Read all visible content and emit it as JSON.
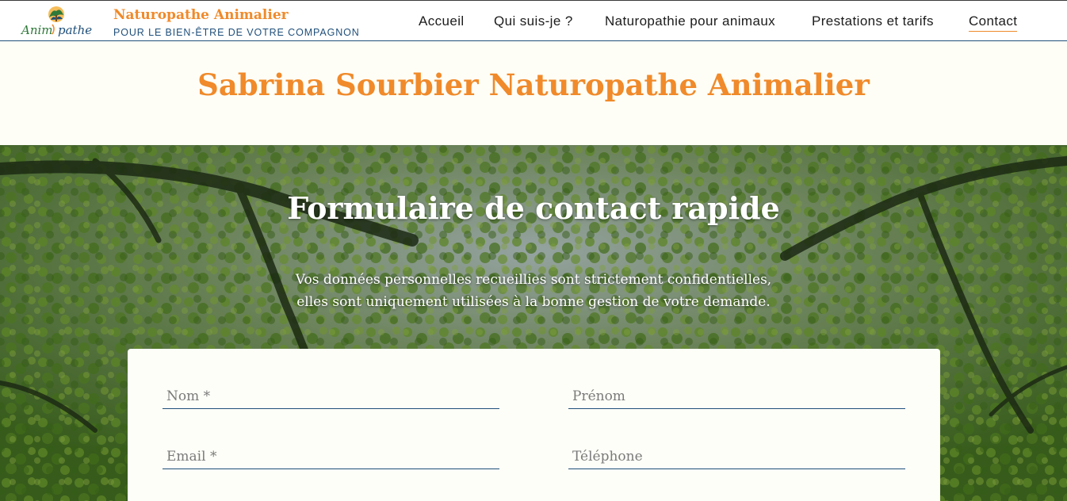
{
  "brand": {
    "logo_text": "Anim pathe",
    "name": "Naturopathe Animalier",
    "tagline": "POUR LE BIEN-ÊTRE DE VOTRE COMPAGNON"
  },
  "nav": {
    "items": [
      {
        "label": "Accueil"
      },
      {
        "label": "Qui suis-je ?"
      },
      {
        "label": "Naturopathie pour animaux"
      },
      {
        "label": "Prestations et tarifs"
      },
      {
        "label": "Contact",
        "active": true
      }
    ]
  },
  "page": {
    "title": "Sabrina Sourbier Naturopathe Animalier"
  },
  "hero": {
    "title": "Formulaire de contact rapide",
    "subtitle_line1": "Vos données personnelles recueillies sont strictement confidentielles,",
    "subtitle_line2": "elles sont uniquement utilisées à la bonne gestion de votre demande."
  },
  "form": {
    "nom": {
      "placeholder": "Nom *",
      "value": ""
    },
    "prenom": {
      "placeholder": "Prénom",
      "value": ""
    },
    "email": {
      "placeholder": "Email *",
      "value": ""
    },
    "telephone": {
      "placeholder": "Téléphone",
      "value": ""
    }
  },
  "colors": {
    "accent": "#f08a2a",
    "navy": "#1f4f7a",
    "cream": "#fefef6",
    "foliage": "#5a8a24"
  }
}
